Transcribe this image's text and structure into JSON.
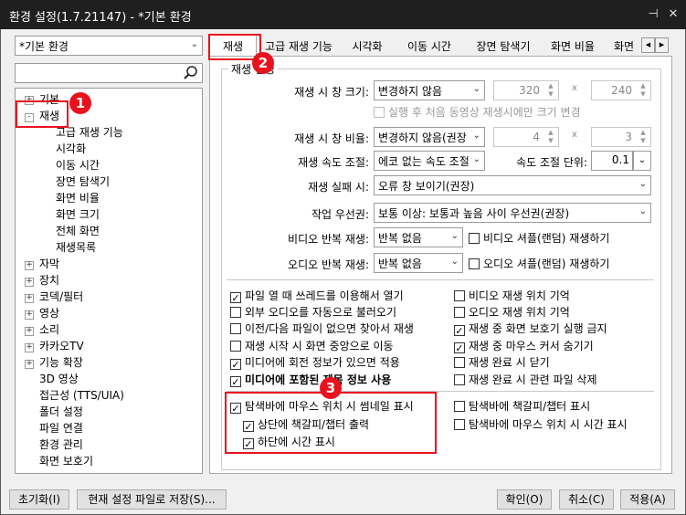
{
  "window": {
    "title": "환경 설정(1.7.21147) - *기본 환경",
    "pin_icon": "pin-icon",
    "close_icon": "close-icon"
  },
  "profile": {
    "selected": "*기본 환경"
  },
  "search": {
    "value": "",
    "icon": "search-icon"
  },
  "tree": {
    "items": [
      "기본",
      "재생",
      "고급 재생 기능",
      "시각화",
      "이동 시간",
      "장면 탐색기",
      "화면 비율",
      "화면 크기",
      "전체 화면",
      "재생목록",
      "자막",
      "장치",
      "코덱/필터",
      "영상",
      "소리",
      "카카오TV",
      "기능 확장",
      "3D 영상",
      "접근성 (TTS/UIA)",
      "폴더 설정",
      "파일 연결",
      "환경 관리",
      "화면 보호기"
    ],
    "expand_plus": "+",
    "expand_minus": "-"
  },
  "tabs": [
    "재생",
    "고급 재생 기능",
    "시각화",
    "이동 시간",
    "장면 탐색기",
    "화면 비율",
    "화면"
  ],
  "tab_scroll": {
    "left": "◀",
    "right": "▶"
  },
  "group": {
    "title": "재생 설정"
  },
  "form": {
    "window_size_label": "재생 시 창 크기:",
    "window_size_value": "변경하지 않음",
    "width": "320",
    "height": "240",
    "times": "x",
    "first_only": "실행 후 처음 동영상 재생시에만 크기 변경",
    "window_ratio_label": "재생 시 창 비율:",
    "window_ratio_value": "변경하지 않음(권장",
    "ratio_w": "4",
    "ratio_h": "3",
    "speed_label": "재생 속도 조절:",
    "speed_value": "에코 없는 속도 조절",
    "speed_unit_label": "속도 조절 단위:",
    "speed_unit_value": "0.1",
    "fail_label": "재생 실패 시:",
    "fail_value": "오류 창 보이기(권장)",
    "priority_label": "작업 우선권:",
    "priority_value": "보통 이상: 보통과 높음 사이 우선권(권장)",
    "video_repeat_label": "비디오 반복 재생:",
    "video_repeat_value": "반복 없음",
    "video_shuffle": "비디오 셔플(랜덤) 재생하기",
    "audio_repeat_label": "오디오 반복 재생:",
    "audio_repeat_value": "반복 없음",
    "audio_shuffle": "오디오 셔플(랜덤) 재생하기"
  },
  "checks_left": [
    {
      "label": "파일 열 때 쓰레드를 이용해서 열기",
      "checked": true
    },
    {
      "label": "외부 오디오를 자동으로 불러오기",
      "checked": false
    },
    {
      "label": "이전/다음 파일이 없으면 찾아서 재생",
      "checked": false
    },
    {
      "label": "재생 시작 시 화면 중앙으로 이동",
      "checked": false
    },
    {
      "label": "미디어에 회전 정보가 있으면 적용",
      "checked": true
    },
    {
      "label": "미디어에 포함된 제목 정보 사용",
      "checked": true
    }
  ],
  "checks_right": [
    {
      "label": "비디오 재생 위치 기억",
      "checked": false
    },
    {
      "label": "오디오 재생 위치 기억",
      "checked": false
    },
    {
      "label": "재생 중 화면 보호기 실행 금지",
      "checked": true
    },
    {
      "label": "재생 중 마우스 커서 숨기기",
      "checked": true
    },
    {
      "label": "재생 완료 시 닫기",
      "checked": false
    },
    {
      "label": "재생 완료 시 관련 파일 삭제",
      "checked": false
    }
  ],
  "seek_checks": {
    "thumb": {
      "label": "탐색바에 마우스 위치 시 썸네일 표시",
      "checked": true
    },
    "top": {
      "label": "상단에 책갈피/챕터 출력",
      "checked": true
    },
    "bottom": {
      "label": "하단에 시간 표시",
      "checked": true
    },
    "chapter": {
      "label": "탐색바에 책갈피/챕터 표시",
      "checked": false
    },
    "time": {
      "label": "탐색바에 마우스 위치 시 시간 표시",
      "checked": false
    }
  },
  "check_mark": "✓",
  "buttons": {
    "reset": "초기화(I)",
    "save_as": "현재 설정 파일로 저장(S)...",
    "ok": "확인(O)",
    "cancel": "취소(C)",
    "apply": "적용(A)"
  },
  "badges": [
    "1",
    "2",
    "3"
  ],
  "colors": {
    "highlight": "#e8121e",
    "titlebar": "#1f1f1f"
  }
}
